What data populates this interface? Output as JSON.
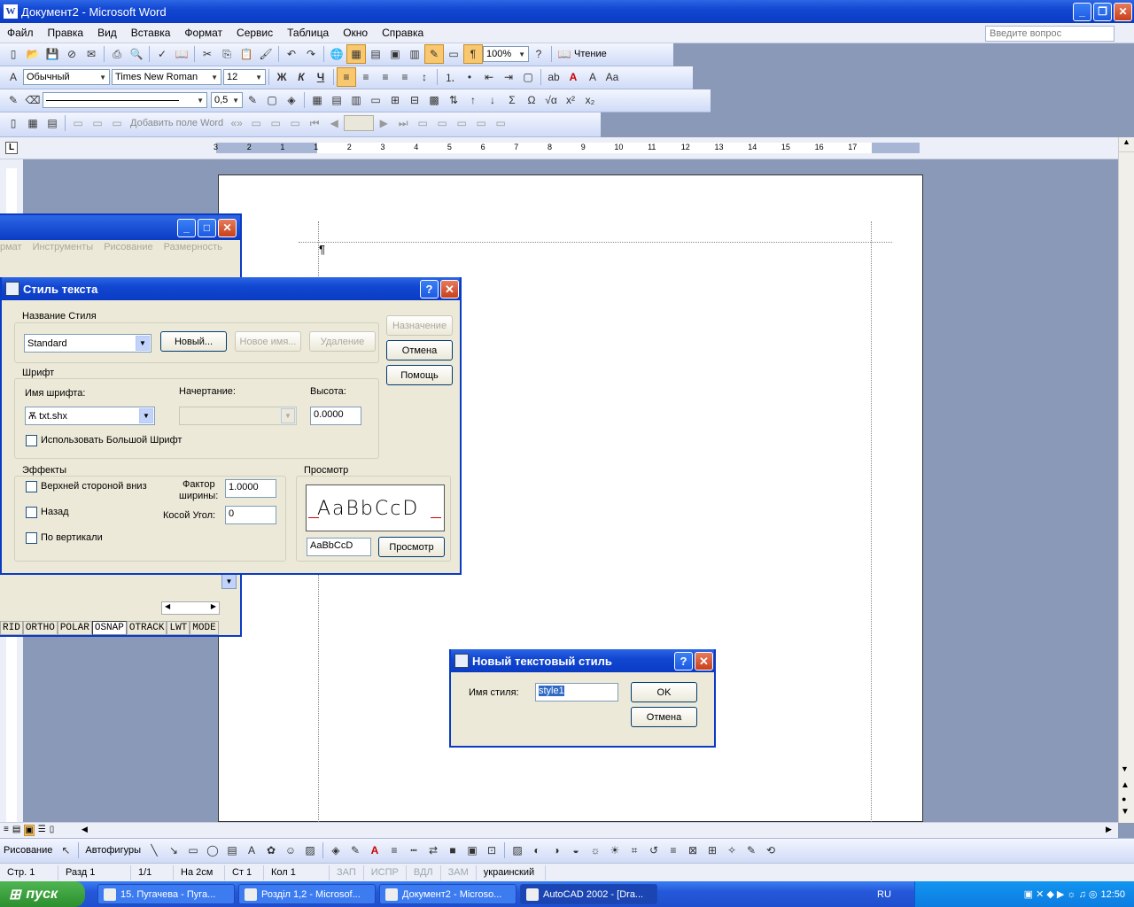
{
  "window": {
    "title": "Документ2 - Microsoft Word",
    "icon_label": "W"
  },
  "menu": {
    "items": [
      "Файл",
      "Правка",
      "Вид",
      "Вставка",
      "Формат",
      "Сервис",
      "Таблица",
      "Окно",
      "Справка"
    ],
    "ask_placeholder": "Введите вопрос"
  },
  "toolbar_standard": {
    "zoom": "100%",
    "reading_label": "Чтение"
  },
  "toolbar_format": {
    "style": "Обычный",
    "font": "Times New Roman",
    "size": "12"
  },
  "toolbar_draw": {
    "line_width": "0,5"
  },
  "toolbar_mailmerge": {
    "add_field": "Добавить поле Word"
  },
  "ruler": {
    "labels": [
      "3",
      "2",
      "1",
      "1",
      "2",
      "3",
      "4",
      "5",
      "6",
      "7",
      "8",
      "9",
      "10",
      "11",
      "12",
      "13",
      "14",
      "15",
      "16",
      "17"
    ]
  },
  "acad": {
    "menus": [
      "рмат",
      "Инструменты",
      "Рисование",
      "Размерность"
    ],
    "status": [
      "RID",
      "ORTHO",
      "POLAR",
      "OSNAP",
      "OTRACK",
      "LWT",
      "MODE"
    ]
  },
  "text_style_dialog": {
    "title": "Стиль текста",
    "style_group": "Название Стиля",
    "style_value": "Standard",
    "btn_new": "Новый...",
    "btn_rename": "Новое имя...",
    "btn_delete": "Удаление",
    "btn_apply": "Назначение",
    "btn_cancel": "Отмена",
    "btn_help": "Помощь",
    "font_group": "Шрифт",
    "font_name_label": "Имя шрифта:",
    "font_name_value": "txt.shx",
    "font_style_label": "Начертание:",
    "height_label": "Высота:",
    "height_value": "0.0000",
    "bigfont_label": "Использовать Большой Шрифт",
    "effects_group": "Эффекты",
    "upside_down": "Верхней стороной вниз",
    "backwards": "Назад",
    "vertical": "По вертикали",
    "width_factor_label1": "Фактор",
    "width_factor_label2": "ширины:",
    "width_factor_value": "1.0000",
    "oblique_label": "Косой Угол:",
    "oblique_value": "0",
    "preview_group": "Просмотр",
    "preview_sample": "AaBbCcD",
    "preview_input": "AaBbCcD",
    "preview_btn": "Просмотр"
  },
  "new_style_dialog": {
    "title": "Новый текстовый стиль",
    "name_label": "Имя стиля:",
    "name_value": "style1",
    "ok": "OK",
    "cancel": "Отмена"
  },
  "drawing_toolbar": {
    "draw": "Рисование",
    "autoshapes": "Автофигуры"
  },
  "statusbar": {
    "page": "Стр. 1",
    "section": "Разд 1",
    "pages": "1/1",
    "at": "На 2см",
    "line": "Ст 1",
    "col": "Кол 1",
    "rec": "ЗАП",
    "trk": "ИСПР",
    "ext": "ВДЛ",
    "ovr": "ЗАМ",
    "lang": "украинский"
  },
  "taskbar": {
    "start": "пуск",
    "tasks": [
      "15. Пугачева - Пуга...",
      "Розділ 1,2 - Microsof...",
      "Документ2 - Microso...",
      "AutoCAD 2002 - [Dra..."
    ],
    "lang": "RU",
    "clock": "12:50"
  }
}
